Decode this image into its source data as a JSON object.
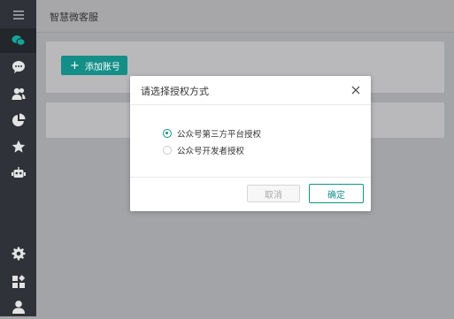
{
  "header": {
    "title": "智慧微客服"
  },
  "sidebar": {
    "items": [
      {
        "name": "menu-icon"
      },
      {
        "name": "wechat-icon"
      },
      {
        "name": "chat-icon"
      },
      {
        "name": "users-icon"
      },
      {
        "name": "pie-chart-icon"
      },
      {
        "name": "star-icon"
      },
      {
        "name": "robot-icon"
      },
      {
        "name": "settings-icon"
      },
      {
        "name": "apps-icon"
      },
      {
        "name": "user-icon"
      }
    ]
  },
  "main": {
    "add_account_label": "添加账号"
  },
  "dialog": {
    "title": "请选择授权方式",
    "options": [
      {
        "label": "公众号第三方平台授权",
        "selected": true
      },
      {
        "label": "公众号开发者授权",
        "selected": false
      }
    ],
    "cancel_label": "取消",
    "confirm_label": "确定"
  },
  "colors": {
    "accent": "#138f88",
    "sidebar": "#2f3238"
  }
}
